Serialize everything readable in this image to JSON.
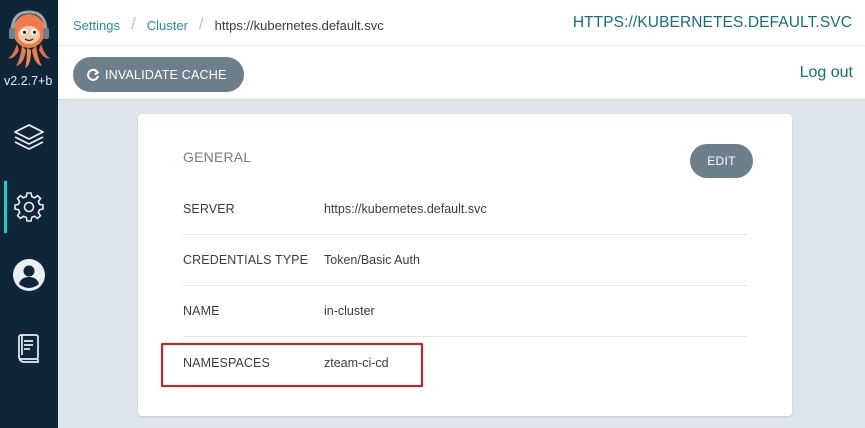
{
  "app": {
    "version": "v2.2.7+b",
    "logo_icon": "argo-octopus-icon"
  },
  "sidebar": {
    "items": [
      {
        "name": "applications",
        "icon": "layers-icon",
        "active": false
      },
      {
        "name": "settings",
        "icon": "gear-icon",
        "active": true
      },
      {
        "name": "user-info",
        "icon": "user-circle-icon",
        "active": false
      },
      {
        "name": "documentation",
        "icon": "book-icon",
        "active": false
      }
    ],
    "accent_color": "#1ad0c9"
  },
  "breadcrumb": {
    "items": [
      "Settings",
      "Cluster"
    ],
    "current": "https://kubernetes.default.svc"
  },
  "header": {
    "title": "HTTPS://KUBERNETES.DEFAULT.SVC",
    "invalidate_label": "INVALIDATE CACHE",
    "logout_label": "Log out"
  },
  "general": {
    "title": "GENERAL",
    "edit_label": "EDIT",
    "rows": [
      {
        "key": "SERVER",
        "value": "https://kubernetes.default.svc"
      },
      {
        "key": "CREDENTIALS TYPE",
        "value": "Token/Basic Auth"
      },
      {
        "key": "NAME",
        "value": "in-cluster"
      },
      {
        "key": "NAMESPACES",
        "value": "zteam-ci-cd"
      }
    ]
  },
  "colors": {
    "sidebar_bg": "#0e2637",
    "link": "#22929c",
    "button_bg": "#6d7f8b",
    "highlight": "#e2141c"
  }
}
